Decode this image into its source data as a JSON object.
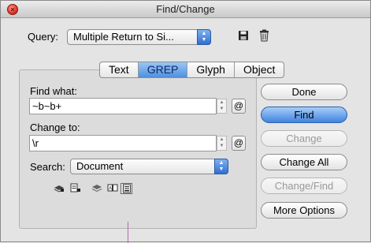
{
  "window": {
    "title": "Find/Change"
  },
  "query": {
    "label": "Query:",
    "selected": "Multiple Return to Si...",
    "save_icon": "floppy-disk-icon",
    "delete_icon": "trash-icon"
  },
  "tabs": [
    {
      "label": "Text",
      "active": false
    },
    {
      "label": "GREP",
      "active": true
    },
    {
      "label": "Glyph",
      "active": false
    },
    {
      "label": "Object",
      "active": false
    }
  ],
  "find": {
    "label": "Find what:",
    "value": "~b~b+",
    "special_button": "@"
  },
  "change": {
    "label": "Change to:",
    "value": "\\r",
    "special_button": "@"
  },
  "search": {
    "label": "Search:",
    "selected": "Document"
  },
  "options_icons": [
    "include-locked-layers-icon",
    "include-locked-stories-icon",
    "include-hidden-layers-icon",
    "include-master-pages-icon",
    "include-footnotes-icon"
  ],
  "buttons": {
    "done": "Done",
    "find": "Find",
    "change": "Change",
    "change_all": "Change All",
    "change_find": "Change/Find",
    "more_options": "More Options"
  },
  "colors": {
    "accent": "#3f84df",
    "close": "#d2281a"
  }
}
